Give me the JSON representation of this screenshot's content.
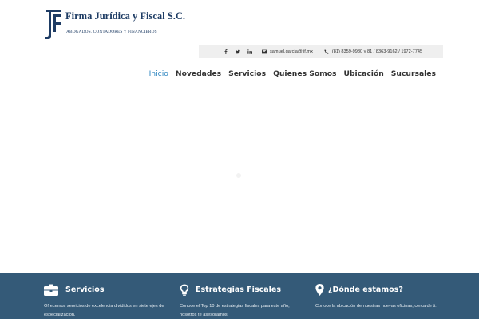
{
  "brand": {
    "name": "Firma Jurídica y Fiscal S.C.",
    "tagline": "ABOGADOS, CONTADORES Y FINANCIEROS",
    "color": "#1e3c64"
  },
  "contact": {
    "social": [
      "facebook-icon",
      "twitter-icon",
      "linkedin-icon"
    ],
    "email": "samuel.garcia@fjf.mx",
    "phone": "(81) 8359-9980 y 81 / 8363-9162 / 1972-7745"
  },
  "nav": {
    "items": [
      {
        "label": "Inicio",
        "active": true
      },
      {
        "label": "Novedades"
      },
      {
        "label": "Servicios"
      },
      {
        "label": "Quienes Somos"
      },
      {
        "label": "Ubicación"
      },
      {
        "label": "Sucursales"
      }
    ],
    "active_color": "#2e86c1"
  },
  "footer": {
    "background": "#345a78",
    "columns": [
      {
        "icon": "briefcase-icon",
        "title": "Servicios",
        "text": "Ofrecemos servicios de excelencia divididos en siete ejes de especialización."
      },
      {
        "icon": "lightbulb-icon",
        "title": "Estrategias Fiscales",
        "text": "Conoce el Top 10 de estrategias fiscales para este año, nosotros te asesoramos!"
      },
      {
        "icon": "map-pin-icon",
        "title": "¿Dónde estamos?",
        "text": "Conoce la ubicación de nuestras nuevas oficinas, cerca de ti."
      }
    ]
  }
}
